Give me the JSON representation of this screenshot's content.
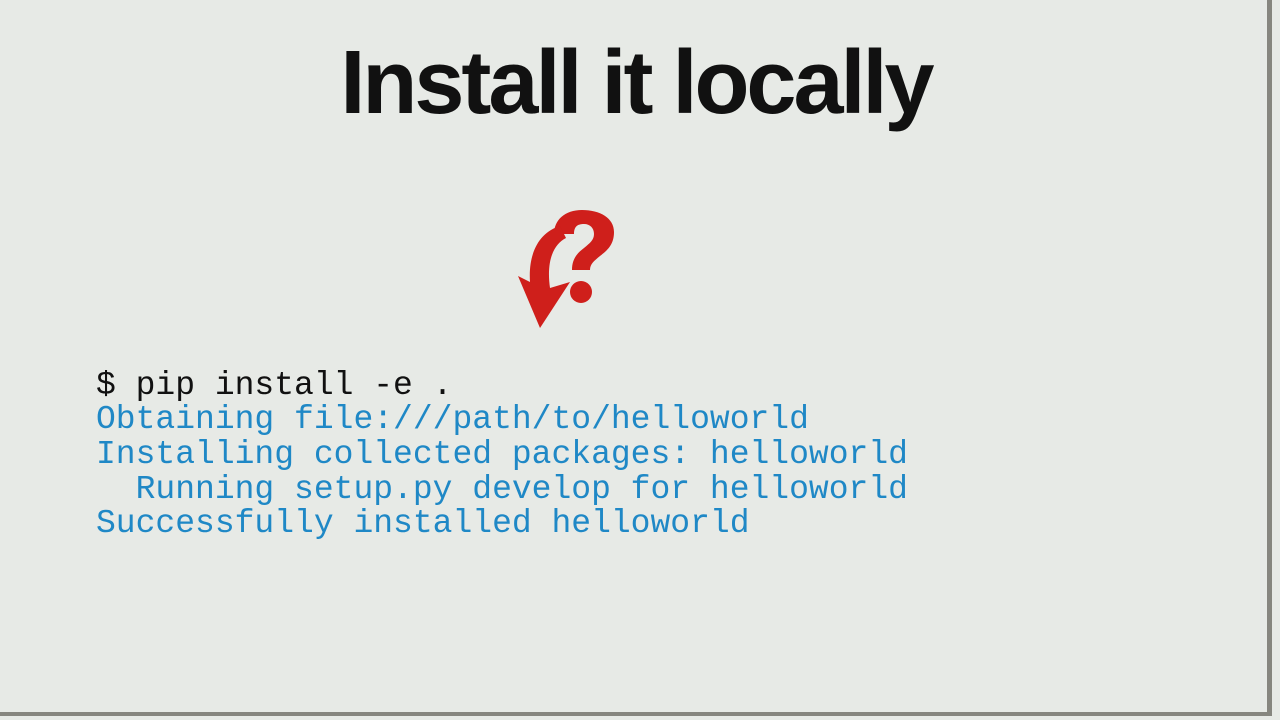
{
  "title": "Install it locally",
  "terminal": {
    "prompt": "$ ",
    "command": "pip install -e .",
    "out1": "Obtaining file:///path/to/helloworld",
    "out2": "Installing collected packages: helloworld",
    "out3": "  Running setup.py develop for helloworld",
    "out4": "Successfully installed helloworld"
  },
  "colors": {
    "accent_red": "#cf1f1b",
    "output_blue": "#1f88c6",
    "bg": "#e7eae6"
  }
}
